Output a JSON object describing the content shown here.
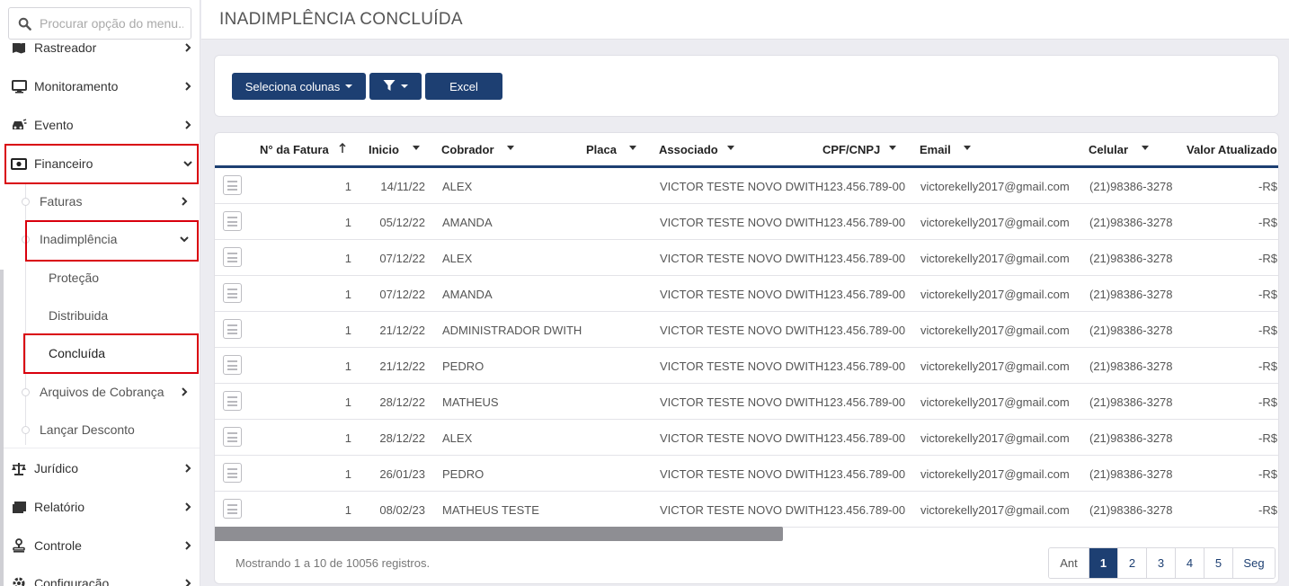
{
  "sidebar": {
    "search_placeholder": "Procurar opção do menu...",
    "items": [
      {
        "label": "Rastreador",
        "icon": "map-icon"
      },
      {
        "label": "Monitoramento",
        "icon": "monitor-icon"
      },
      {
        "label": "Evento",
        "icon": "car-crash-icon"
      },
      {
        "label": "Financeiro",
        "icon": "money-icon"
      },
      {
        "label": "Jurídico",
        "icon": "scale-icon"
      },
      {
        "label": "Relatório",
        "icon": "report-icon"
      },
      {
        "label": "Controle",
        "icon": "stamp-icon"
      },
      {
        "label": "Configuração",
        "icon": "gear-icon"
      }
    ],
    "financeiro_sub": [
      {
        "label": "Faturas"
      },
      {
        "label": "Inadimplência"
      },
      {
        "label": "Arquivos de Cobrança"
      },
      {
        "label": "Lançar Desconto"
      }
    ],
    "inadimplencia_sub": [
      {
        "label": "Proteção"
      },
      {
        "label": "Distribuida"
      },
      {
        "label": "Concluída"
      }
    ]
  },
  "header": {
    "title": "INADIMPLÊNCIA CONCLUÍDA"
  },
  "toolbar": {
    "columns_label": "Seleciona colunas",
    "excel_label": "Excel"
  },
  "table": {
    "headers": [
      "N° da Fatura",
      "Inicio",
      "Cobrador",
      "Placa",
      "Associado",
      "CPF/CNPJ",
      "Email",
      "Celular",
      "Valor Atualizado"
    ],
    "rows": [
      {
        "fatura": "1",
        "inicio": "14/11/22",
        "cobrador": "ALEX",
        "placa": "",
        "associado": "VICTOR TESTE NOVO DWITH",
        "cpf": "123.456.789-00",
        "email": "victorekelly2017@gmail.com",
        "celular": "(21)98386-3278",
        "valor": "-R$"
      },
      {
        "fatura": "1",
        "inicio": "05/12/22",
        "cobrador": "AMANDA",
        "placa": "",
        "associado": "VICTOR TESTE NOVO DWITH",
        "cpf": "123.456.789-00",
        "email": "victorekelly2017@gmail.com",
        "celular": "(21)98386-3278",
        "valor": "-R$"
      },
      {
        "fatura": "1",
        "inicio": "07/12/22",
        "cobrador": "ALEX",
        "placa": "",
        "associado": "VICTOR TESTE NOVO DWITH",
        "cpf": "123.456.789-00",
        "email": "victorekelly2017@gmail.com",
        "celular": "(21)98386-3278",
        "valor": "-R$"
      },
      {
        "fatura": "1",
        "inicio": "07/12/22",
        "cobrador": "AMANDA",
        "placa": "",
        "associado": "VICTOR TESTE NOVO DWITH",
        "cpf": "123.456.789-00",
        "email": "victorekelly2017@gmail.com",
        "celular": "(21)98386-3278",
        "valor": "-R$"
      },
      {
        "fatura": "1",
        "inicio": "21/12/22",
        "cobrador": "ADMINISTRADOR DWITH",
        "placa": "",
        "associado": "VICTOR TESTE NOVO DWITH",
        "cpf": "123.456.789-00",
        "email": "victorekelly2017@gmail.com",
        "celular": "(21)98386-3278",
        "valor": "-R$"
      },
      {
        "fatura": "1",
        "inicio": "21/12/22",
        "cobrador": "PEDRO",
        "placa": "",
        "associado": "VICTOR TESTE NOVO DWITH",
        "cpf": "123.456.789-00",
        "email": "victorekelly2017@gmail.com",
        "celular": "(21)98386-3278",
        "valor": "-R$"
      },
      {
        "fatura": "1",
        "inicio": "28/12/22",
        "cobrador": "MATHEUS",
        "placa": "",
        "associado": "VICTOR TESTE NOVO DWITH",
        "cpf": "123.456.789-00",
        "email": "victorekelly2017@gmail.com",
        "celular": "(21)98386-3278",
        "valor": "-R$"
      },
      {
        "fatura": "1",
        "inicio": "28/12/22",
        "cobrador": "ALEX",
        "placa": "",
        "associado": "VICTOR TESTE NOVO DWITH",
        "cpf": "123.456.789-00",
        "email": "victorekelly2017@gmail.com",
        "celular": "(21)98386-3278",
        "valor": "-R$"
      },
      {
        "fatura": "1",
        "inicio": "26/01/23",
        "cobrador": "PEDRO",
        "placa": "",
        "associado": "VICTOR TESTE NOVO DWITH",
        "cpf": "123.456.789-00",
        "email": "victorekelly2017@gmail.com",
        "celular": "(21)98386-3278",
        "valor": "-R$"
      },
      {
        "fatura": "1",
        "inicio": "08/02/23",
        "cobrador": "MATHEUS TESTE",
        "placa": "",
        "associado": "VICTOR TESTE NOVO DWITH",
        "cpf": "123.456.789-00",
        "email": "victorekelly2017@gmail.com",
        "celular": "(21)98386-3278",
        "valor": "-R$"
      }
    ],
    "row_icon": "document-list-icon",
    "footer_info": "Mostrando 1 a 10 de 10056 registros."
  },
  "pagination": {
    "prev": "Ant",
    "pages": [
      "1",
      "2",
      "3",
      "4",
      "5"
    ],
    "current": "1",
    "next": "Seg"
  },
  "colors": {
    "primary": "#1d3f72",
    "highlight": "#d9000d"
  }
}
